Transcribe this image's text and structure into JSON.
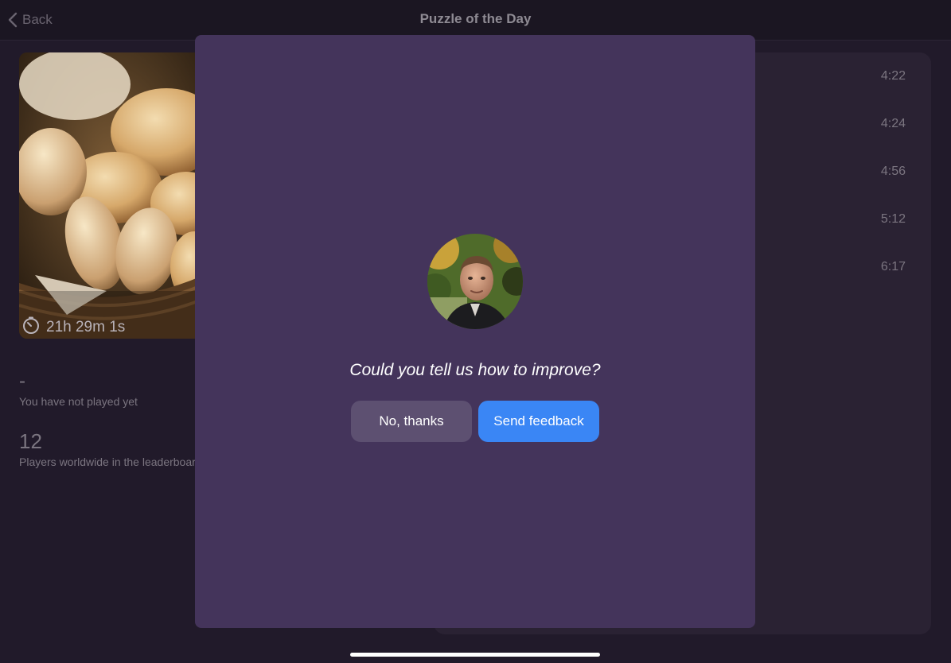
{
  "navbar": {
    "back_label": "Back",
    "title": "Puzzle of the Day"
  },
  "puzzle": {
    "timer": "21h 29m 1s",
    "image_icon": "bread-basket-photo"
  },
  "stats": {
    "score": "-",
    "score_note": "You have not played yet",
    "players_count": "12",
    "players_label": "Players worldwide in the leaderboard"
  },
  "leaderboard": {
    "times": [
      "4:22",
      "4:24",
      "4:56",
      "5:12",
      "6:17"
    ]
  },
  "feedback_modal": {
    "question": "Could you tell us how to improve?",
    "decline_label": "No, thanks",
    "accept_label": "Send feedback"
  },
  "colors": {
    "modal_bg": "#44345b",
    "accent": "#3a86f5",
    "secondary_button": "#5d5071"
  }
}
